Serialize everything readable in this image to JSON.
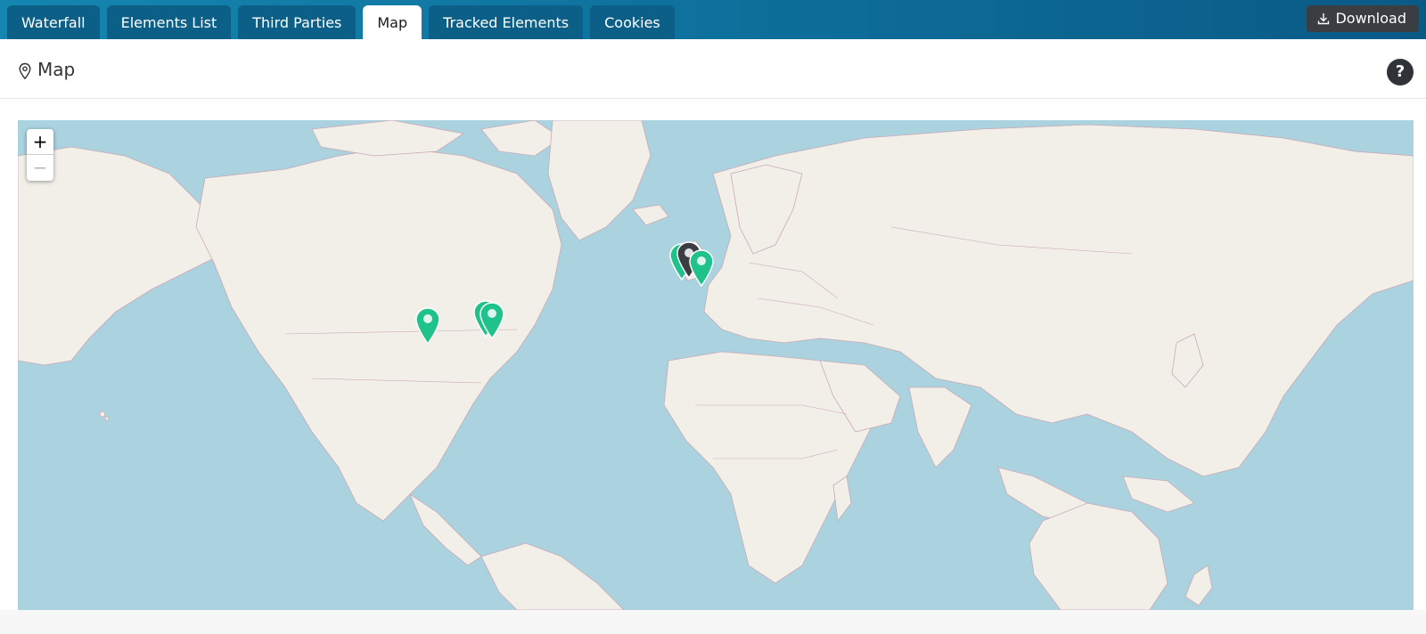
{
  "tabs": [
    {
      "label": "Waterfall",
      "active": false
    },
    {
      "label": "Elements List",
      "active": false
    },
    {
      "label": "Third Parties",
      "active": false
    },
    {
      "label": "Map",
      "active": true
    },
    {
      "label": "Tracked Elements",
      "active": false
    },
    {
      "label": "Cookies",
      "active": false
    }
  ],
  "download_label": "Download",
  "section": {
    "title": "Map",
    "icon": "map-pin-icon"
  },
  "help_label": "?",
  "map": {
    "zoom_in_label": "+",
    "zoom_out_label": "−",
    "zoom_out_disabled": true,
    "colors": {
      "water": "#aad3df",
      "land": "#f2efe9",
      "borders": "#c9a9b6",
      "marker_green": "#1fc28a",
      "marker_dark": "#3a3d42"
    },
    "markers": [
      {
        "name": "marker-us-central",
        "color": "green"
      },
      {
        "name": "marker-us-east-1",
        "color": "green"
      },
      {
        "name": "marker-us-east-2",
        "color": "green"
      },
      {
        "name": "marker-uk-green",
        "color": "green"
      },
      {
        "name": "marker-uk-dark",
        "color": "dark"
      },
      {
        "name": "marker-europe-west",
        "color": "green"
      }
    ]
  }
}
